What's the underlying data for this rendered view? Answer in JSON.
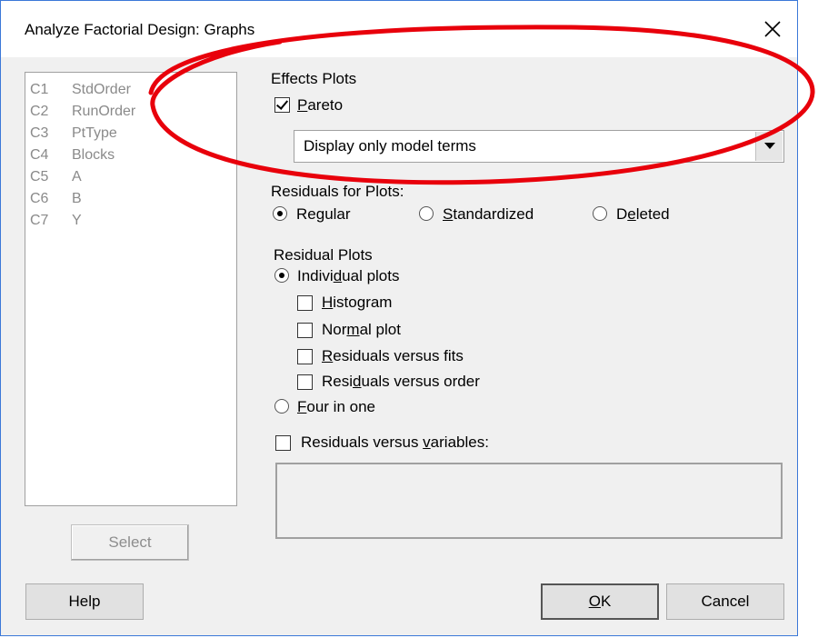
{
  "window": {
    "title": "Analyze Factorial Design: Graphs",
    "close_glyph": "✕"
  },
  "variables": [
    {
      "col": "C1",
      "name": "StdOrder"
    },
    {
      "col": "C2",
      "name": "RunOrder"
    },
    {
      "col": "C3",
      "name": "PtType"
    },
    {
      "col": "C4",
      "name": "Blocks"
    },
    {
      "col": "C5",
      "name": "A"
    },
    {
      "col": "C6",
      "name": "B"
    },
    {
      "col": "C7",
      "name": "Y"
    }
  ],
  "select_button": "Select",
  "effects_plots": {
    "heading": "Effects Plots",
    "pareto": {
      "label_u": "P",
      "label_rest": "areto",
      "checked": true
    },
    "dropdown_value": "Display only model terms"
  },
  "residuals_for_plots": {
    "heading": "Residuals for Plots:",
    "options": [
      {
        "pre": "Re",
        "u": "g",
        "post": "ular",
        "selected": true
      },
      {
        "pre": "",
        "u": "S",
        "post": "tandardized",
        "selected": false
      },
      {
        "pre": "D",
        "u": "e",
        "post": "leted",
        "selected": false
      }
    ]
  },
  "residual_plots": {
    "heading": "Residual Plots",
    "individual": {
      "pre": "Indivi",
      "u": "d",
      "post": "ual plots",
      "selected": true
    },
    "checks": [
      {
        "pre": "",
        "u": "H",
        "post": "istogram",
        "checked": false
      },
      {
        "pre": "Nor",
        "u": "m",
        "post": "al plot",
        "checked": false
      },
      {
        "pre": "",
        "u": "R",
        "post": "esiduals versus fits",
        "checked": false
      },
      {
        "pre": "Resi",
        "u": "d",
        "post": "uals versus order",
        "checked": false
      }
    ],
    "four_in_one": {
      "pre": "",
      "u": "F",
      "post": "our in one",
      "selected": false
    }
  },
  "residuals_vs_variables": {
    "pre": "Residuals versus ",
    "u": "v",
    "post": "ariables:",
    "checked": false
  },
  "buttons": {
    "help": "Help",
    "ok_u": "O",
    "ok_rest": "K",
    "cancel": "Cancel"
  },
  "colors": {
    "annotation": "#e8000b",
    "window_border": "#3b78d8",
    "dialog_bg": "#f0f0f0"
  }
}
